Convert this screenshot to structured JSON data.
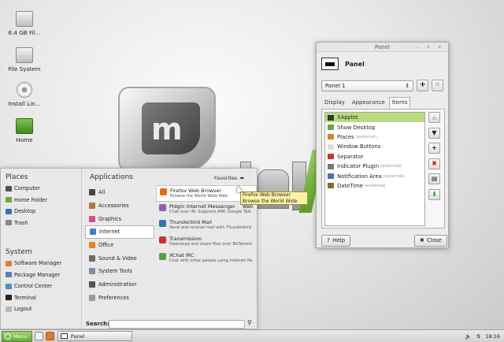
{
  "desktop": {
    "icons": [
      {
        "label": "6.4 GB Fil...",
        "icon": "drive-icon"
      },
      {
        "label": "File System",
        "icon": "drive-icon"
      },
      {
        "label": "Install Lin...",
        "icon": "disc-icon"
      },
      {
        "label": "Home",
        "icon": "home-folder-icon"
      }
    ]
  },
  "panel_window": {
    "title": "Panel",
    "controls": "– + ×",
    "heading": "Panel",
    "selected_panel": "Panel 1",
    "add_label": "+",
    "remove_label": "×",
    "tabs": [
      "Display",
      "Appearance",
      "Items"
    ],
    "active_tab": "Items",
    "items": [
      {
        "label": "XApplet",
        "ext": "",
        "selected": true,
        "color": "#333333"
      },
      {
        "label": "Show Desktop",
        "ext": "",
        "color": "#6aa83a"
      },
      {
        "label": "Places",
        "ext": "(external)",
        "color": "#d9822b"
      },
      {
        "label": "Window Buttons",
        "ext": "",
        "color": "#dddddd"
      },
      {
        "label": "Separator",
        "ext": "",
        "color": "#c0392b"
      },
      {
        "label": "Indicator Plugin",
        "ext": "(external)",
        "color": "#777777"
      },
      {
        "label": "Notification Area",
        "ext": "(external)",
        "color": "#4a6fb5"
      },
      {
        "label": "DateTime",
        "ext": "(external)",
        "color": "#8a6a2a"
      }
    ],
    "side_buttons": [
      "▲",
      "▼",
      "+",
      "✖",
      "▤",
      "⬇"
    ],
    "help_label": "Help",
    "close_label": "Close"
  },
  "menu": {
    "places_heading": "Places",
    "places": [
      {
        "label": "Computer",
        "color": "#555555"
      },
      {
        "label": "Home Folder",
        "color": "#6aa83a"
      },
      {
        "label": "Desktop",
        "color": "#3b6fb6"
      },
      {
        "label": "Trash",
        "color": "#888888"
      }
    ],
    "system_heading": "System",
    "system": [
      {
        "label": "Software Manager",
        "color": "#d9822b"
      },
      {
        "label": "Package Manager",
        "color": "#5a7fb3"
      },
      {
        "label": "Control Center",
        "color": "#4d8fd1"
      },
      {
        "label": "Terminal",
        "color": "#222222"
      },
      {
        "label": "Logout",
        "color": "#b8b8b8"
      }
    ],
    "applications_heading": "Applications",
    "favorites_label": "Favorites",
    "categories": [
      {
        "label": "All",
        "color": "#444444"
      },
      {
        "label": "Accessories",
        "color": "#b07a3a"
      },
      {
        "label": "Graphics",
        "color": "#d44c8c"
      },
      {
        "label": "Internet",
        "color": "#3b7fd6",
        "active": true
      },
      {
        "label": "Office",
        "color": "#e08a1e"
      },
      {
        "label": "Sound & Video",
        "color": "#6a6a6a"
      },
      {
        "label": "System Tools",
        "color": "#7a8fa5"
      },
      {
        "label": "Administration",
        "color": "#555555"
      },
      {
        "label": "Preferences",
        "color": "#9a9a9a"
      }
    ],
    "apps": [
      {
        "name": "Firefox Web Browser",
        "desc": "Browse the World Wide Web",
        "color": "#e66a1e",
        "active": true
      },
      {
        "name": "Pidgin Internet Messenger",
        "desc": "Chat over IM.  Supports AIM, Google Talk",
        "color": "#8a5fb0"
      },
      {
        "name": "Thunderbird Mail",
        "desc": "Send and receive mail with Thunderbird",
        "color": "#3a6fb5"
      },
      {
        "name": "Transmission",
        "desc": "Download and share files over BitTorrent",
        "color": "#c7372f"
      },
      {
        "name": "XChat IRC",
        "desc": "Chat with other people using Internet Rel...",
        "color": "#5aa03a"
      }
    ],
    "search_label": "Search:",
    "search_value": ""
  },
  "tooltip": {
    "line1": "Firefox Web Browser",
    "line2": "Browse the World Wide Web"
  },
  "taskbar": {
    "menu_label": "Menu",
    "task_label": "Panel",
    "time": "18:16"
  }
}
